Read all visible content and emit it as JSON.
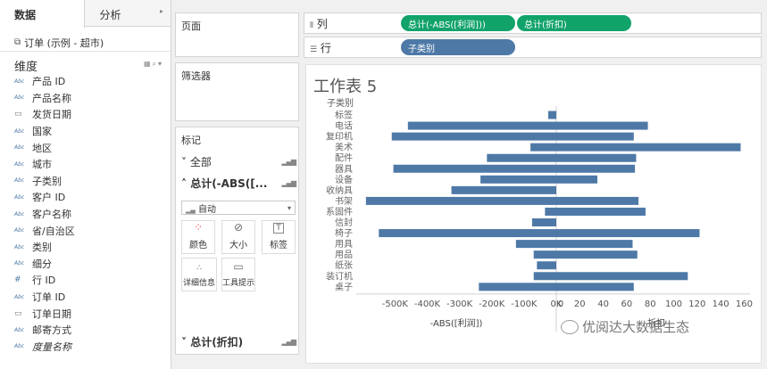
{
  "data_pane": {
    "tabs": {
      "data": "数据",
      "analysis": "分析"
    },
    "datasource": "订单 (示例 - 超市)",
    "dimensions_header": "维度",
    "fields": [
      {
        "type": "Abc",
        "name": "产品 ID"
      },
      {
        "type": "Abc",
        "name": "产品名称"
      },
      {
        "type": "cal",
        "name": "发货日期"
      },
      {
        "type": "Abc",
        "name": "国家"
      },
      {
        "type": "Abc",
        "name": "地区"
      },
      {
        "type": "Abc",
        "name": "城市"
      },
      {
        "type": "Abc",
        "name": "子类别"
      },
      {
        "type": "Abc",
        "name": "客户 ID"
      },
      {
        "type": "Abc",
        "name": "客户名称"
      },
      {
        "type": "Abc",
        "name": "省/自治区"
      },
      {
        "type": "Abc",
        "name": "类别"
      },
      {
        "type": "Abc",
        "name": "细分"
      },
      {
        "type": "#",
        "name": "行 ID"
      },
      {
        "type": "Abc",
        "name": "订单 ID"
      },
      {
        "type": "cal",
        "name": "订单日期"
      },
      {
        "type": "Abc",
        "name": "邮寄方式"
      },
      {
        "type": "Abc",
        "name": "度量名称"
      }
    ]
  },
  "cards": {
    "pages": "页面",
    "filters": "筛选器",
    "marks": "标记",
    "marks_all": "全部",
    "marks_sum_abs": "总计(-ABS([...",
    "mark_type": "自动",
    "buttons": {
      "color": "颜色",
      "size": "大小",
      "label": "标签",
      "detail": "详细信息",
      "tooltip": "工具提示"
    },
    "marks_sum_discount": "总计(折扣)"
  },
  "shelves": {
    "columns_label": "列",
    "rows_label": "行",
    "column_pills": [
      "总计(-ABS([利润]))",
      "总计(折扣)"
    ],
    "row_pills": [
      "子类别"
    ]
  },
  "sheet": {
    "title": "工作表 5"
  },
  "chart_data": {
    "type": "bar",
    "orientation": "horizontal",
    "row_header": "子类别",
    "categories": [
      "标签",
      "电话",
      "复印机",
      "美术",
      "配件",
      "器具",
      "设备",
      "收纳具",
      "书架",
      "系固件",
      "信封",
      "椅子",
      "用具",
      "用品",
      "纸张",
      "装订机",
      "桌子"
    ],
    "series": [
      {
        "axis_title": "-ABS([利润])",
        "values": [
          -25000,
          -460000,
          -510000,
          -80000,
          -215000,
          -505000,
          -235000,
          -325000,
          -590000,
          -35000,
          -75000,
          -550000,
          -125000,
          -70000,
          -60000,
          -70000,
          -240000
        ],
        "xlim": [
          -620000,
          0
        ],
        "ticks": [
          -500000,
          -400000,
          -300000,
          -200000,
          -100000,
          0
        ],
        "tick_labels": [
          "-500K",
          "-400K",
          "-300K",
          "-200K",
          "-100K",
          "0K"
        ]
      },
      {
        "axis_title": "折扣",
        "values": [
          0,
          78,
          66,
          157,
          68,
          67,
          35,
          0,
          70,
          76,
          0,
          122,
          65,
          69,
          0,
          112,
          66
        ],
        "xlim": [
          0,
          165
        ],
        "ticks": [
          0,
          20,
          40,
          60,
          80,
          100,
          120,
          140,
          160
        ],
        "tick_labels": [
          "0",
          "20",
          "40",
          "60",
          "80",
          "100",
          "120",
          "140",
          "160"
        ]
      }
    ],
    "bar_color": "#4e79a7"
  },
  "watermark": "优阅达大数据生态"
}
